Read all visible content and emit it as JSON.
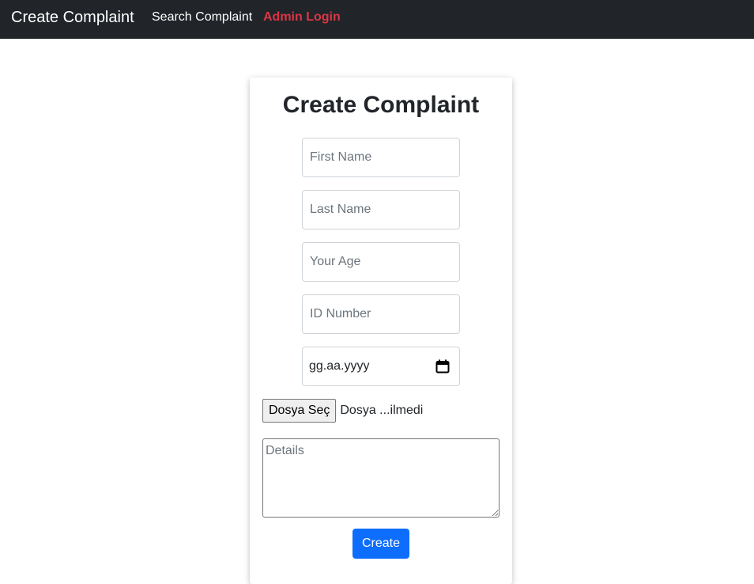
{
  "navbar": {
    "brand": "Create Complaint",
    "links": [
      "Search Complaint",
      "Admin Login"
    ],
    "admin_color": "#dc3545"
  },
  "form": {
    "title": "Create Complaint",
    "first_name_placeholder": "First Name",
    "last_name_placeholder": "Last Name",
    "age_placeholder": "Your Age",
    "id_placeholder": "ID Number",
    "date_placeholder": "gg.aa.yyyy",
    "file_button": "Dosya Seç",
    "file_status": "Dosya ...ilmedi",
    "details_placeholder": "Details",
    "submit_label": "Create",
    "submit_color": "#0d6efd",
    "calendar_icon": "calendar-icon"
  }
}
